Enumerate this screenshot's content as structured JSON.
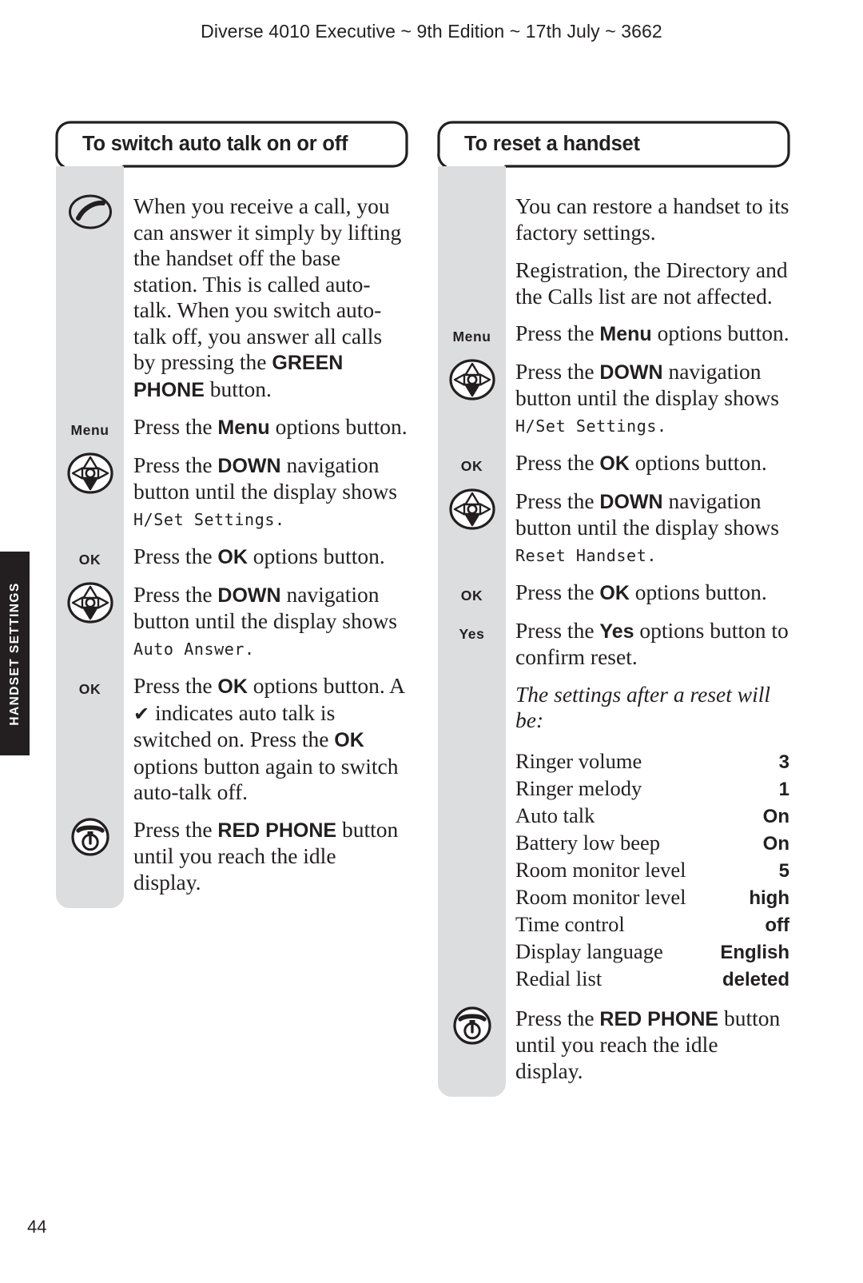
{
  "page": {
    "running_head": "Diverse 4010 Executive ~ 9th Edition ~ 17th July ~ 3662",
    "side_tab": "HANDSET SETTINGS",
    "folio": "44"
  },
  "columns": [
    {
      "heading": "To switch auto talk on or off",
      "steps": [
        {
          "cue": {
            "type": "icon",
            "icon": "green-phone-icon"
          },
          "text_parts": [
            {
              "t": "When you receive a call, you can answer it simply by lifting the handset off the base station. This is called auto-talk. When you switch auto-talk off, you answer all calls by pressing the "
            },
            {
              "t": "GREEN PHONE",
              "s": "bold"
            },
            {
              "t": " button."
            }
          ]
        },
        {
          "cue": {
            "type": "text",
            "label": "Menu"
          },
          "text_parts": [
            {
              "t": "Press the "
            },
            {
              "t": "Menu",
              "s": "bold"
            },
            {
              "t": " options button."
            }
          ]
        },
        {
          "cue": {
            "type": "icon",
            "icon": "navigation-down-icon"
          },
          "text_parts": [
            {
              "t": "Press the "
            },
            {
              "t": "DOWN",
              "s": "bold"
            },
            {
              "t": " navigation button until the display shows "
            },
            {
              "t": "H/Set Settings.",
              "s": "lcd"
            }
          ]
        },
        {
          "cue": {
            "type": "text",
            "label": "OK"
          },
          "text_parts": [
            {
              "t": "Press the "
            },
            {
              "t": "OK",
              "s": "bold"
            },
            {
              "t": " options button."
            }
          ]
        },
        {
          "cue": {
            "type": "icon",
            "icon": "navigation-down-icon"
          },
          "text_parts": [
            {
              "t": "Press the "
            },
            {
              "t": "DOWN",
              "s": "bold"
            },
            {
              "t": " navigation button until the display shows "
            },
            {
              "t": "Auto Answer.",
              "s": "lcd"
            }
          ]
        },
        {
          "cue": {
            "type": "text",
            "label": "OK"
          },
          "text_parts": [
            {
              "t": "Press the "
            },
            {
              "t": "OK",
              "s": "bold"
            },
            {
              "t": " options button. A "
            },
            {
              "t": "✔",
              "s": "tick"
            },
            {
              "t": " indicates auto talk is switched on. Press the "
            },
            {
              "t": "OK",
              "s": "bold"
            },
            {
              "t": " options button again to switch auto-talk off."
            }
          ]
        },
        {
          "cue": {
            "type": "icon",
            "icon": "red-phone-icon"
          },
          "text_parts": [
            {
              "t": "Press the "
            },
            {
              "t": "RED PHONE",
              "s": "bold"
            },
            {
              "t": " button until you reach the idle display."
            }
          ]
        }
      ]
    },
    {
      "heading": "To reset a handset",
      "steps": [
        {
          "cue": {
            "type": "none"
          },
          "paragraphs": [
            [
              {
                "t": "You can restore a handset to its factory settings."
              }
            ],
            [
              {
                "t": "Registration, the Directory and the Calls list are not affected."
              }
            ]
          ]
        },
        {
          "cue": {
            "type": "text",
            "label": "Menu"
          },
          "text_parts": [
            {
              "t": "Press the "
            },
            {
              "t": "Menu",
              "s": "bold"
            },
            {
              "t": " options button."
            }
          ]
        },
        {
          "cue": {
            "type": "icon",
            "icon": "navigation-down-icon"
          },
          "text_parts": [
            {
              "t": "Press the "
            },
            {
              "t": "DOWN",
              "s": "bold"
            },
            {
              "t": " navigation button until the display shows "
            },
            {
              "t": "H/Set Settings.",
              "s": "lcd"
            }
          ]
        },
        {
          "cue": {
            "type": "text",
            "label": "OK"
          },
          "text_parts": [
            {
              "t": "Press the "
            },
            {
              "t": "OK",
              "s": "bold"
            },
            {
              "t": " options button."
            }
          ]
        },
        {
          "cue": {
            "type": "icon",
            "icon": "navigation-down-icon"
          },
          "text_parts": [
            {
              "t": "Press the "
            },
            {
              "t": "DOWN",
              "s": "bold"
            },
            {
              "t": " navigation button until the display shows "
            },
            {
              "t": "Reset Handset.",
              "s": "lcd"
            }
          ]
        },
        {
          "cue": {
            "type": "text",
            "label": "OK"
          },
          "text_parts": [
            {
              "t": "Press the "
            },
            {
              "t": "OK",
              "s": "bold"
            },
            {
              "t": " options button."
            }
          ]
        },
        {
          "cue": {
            "type": "text",
            "label": "Yes"
          },
          "text_parts": [
            {
              "t": "Press the "
            },
            {
              "t": "Yes",
              "s": "bold"
            },
            {
              "t": " options button to confirm reset."
            }
          ]
        },
        {
          "cue": {
            "type": "none"
          },
          "text_parts": [
            {
              "t": "The settings after a reset will be:",
              "s": "italic"
            }
          ]
        },
        {
          "cue": {
            "type": "none"
          },
          "table": {
            "rows": [
              {
                "label": "Ringer volume",
                "value": "3"
              },
              {
                "label": "Ringer melody",
                "value": "1"
              },
              {
                "label": "Auto talk",
                "value": "On"
              },
              {
                "label": "Battery low beep",
                "value": "On"
              },
              {
                "label": "Room monitor level",
                "value": "5"
              },
              {
                "label": "Room monitor level",
                "value": "high"
              },
              {
                "label": "Time control",
                "value": "off"
              },
              {
                "label": "Display language",
                "value": "English"
              },
              {
                "label": "Redial list",
                "value": "deleted"
              }
            ]
          }
        },
        {
          "cue": {
            "type": "icon",
            "icon": "red-phone-icon"
          },
          "text_parts": [
            {
              "t": "Press the "
            },
            {
              "t": "RED PHONE",
              "s": "bold"
            },
            {
              "t": " button until you reach the idle display."
            }
          ]
        }
      ]
    }
  ],
  "colors": {
    "ink": "#231f20",
    "rail": "#dcdddf",
    "tab_bg": "#231f20",
    "tab_text": "#ffffff",
    "page_bg": "#ffffff"
  }
}
